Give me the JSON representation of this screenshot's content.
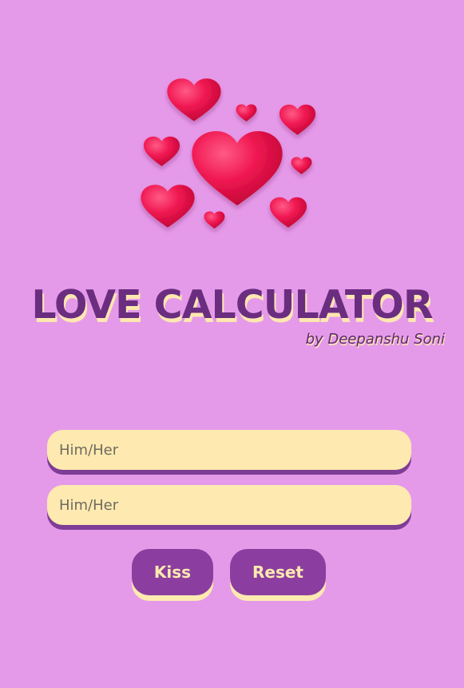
{
  "header": {
    "title": "LOVE CALCULATOR",
    "byline": "by Deepanshu Soni"
  },
  "form": {
    "first_placeholder": "Him/Her",
    "second_placeholder": "Him/Her"
  },
  "buttons": {
    "kiss_label": "Kiss",
    "reset_label": "Reset"
  },
  "colors": {
    "background": "#e59ae9",
    "title": "#6a2d80",
    "heart": "#e8174b",
    "input_bg": "#feeab0",
    "button_bg": "#8b3e9f",
    "button_text": "#feeab0"
  },
  "icons": {
    "logo": "hearts-cluster-icon"
  }
}
